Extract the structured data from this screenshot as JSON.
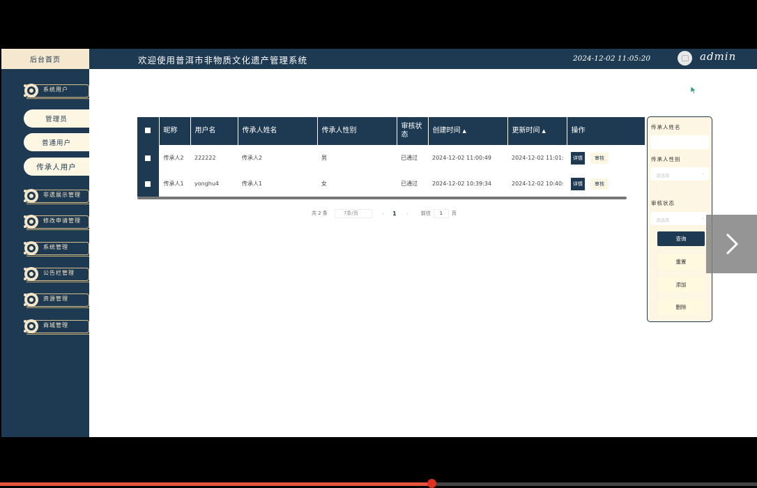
{
  "header": {
    "home_tab": "后台首页",
    "title": "欢迎使用普洱市非物质文化遗产管理系统",
    "datetime": "2024-12-02 11:05:20",
    "username": "admin"
  },
  "sidebar": {
    "groups": [
      {
        "label": "系统用户",
        "children": [
          "管理员",
          "普通用户",
          "传承人用户"
        ]
      },
      {
        "label": "非遗展示管理"
      },
      {
        "label": "修改申请管理"
      },
      {
        "label": "系统管理"
      },
      {
        "label": "公告栏管理"
      },
      {
        "label": "资源管理"
      },
      {
        "label": "商城管理"
      }
    ]
  },
  "table": {
    "columns": [
      "昵称",
      "用户名",
      "传承人姓名",
      "传承人性别",
      "审核状态",
      "创建时间",
      "更新时间",
      "操作"
    ],
    "rows": [
      {
        "nickname": "传承人2",
        "username": "222222",
        "name": "传承人2",
        "gender": "男",
        "status": "已通过",
        "created": "2024-12-02 11:00:49",
        "updated": "2024-12-02 11:01:",
        "detail": "详情",
        "review": "审核"
      },
      {
        "nickname": "传承人1",
        "username": "yonghu4",
        "name": "传承人1",
        "gender": "女",
        "status": "已通过",
        "created": "2024-12-02 10:39:34",
        "updated": "2024-12-02 10:40:",
        "detail": "详情",
        "review": "审核"
      }
    ]
  },
  "pagination": {
    "total": "共 2 条",
    "page_size": "7条/页",
    "prev": "‹",
    "current": "1",
    "next": "›",
    "goto_label": "前往",
    "goto_value": "1",
    "page_unit": "页"
  },
  "search_panel": {
    "name_label": "传承人姓名",
    "gender_label": "传承人性别",
    "gender_placeholder": "请选择",
    "status_label": "审核状态",
    "status_placeholder": "请选择",
    "query": "查询",
    "reset": "重置",
    "add": "添加",
    "delete": "删除"
  },
  "video": {
    "progress": 0.57
  },
  "colors": {
    "primary": "#1e3a52",
    "cream": "#fdf6e3",
    "gold": "#d9bf8a",
    "video_red": "#e8553d"
  },
  "icons": [
    "ornament-icon",
    "sort-icon",
    "chevron-right-icon",
    "avatar-icon",
    "cursor-icon",
    "chevron-down-icon"
  ]
}
